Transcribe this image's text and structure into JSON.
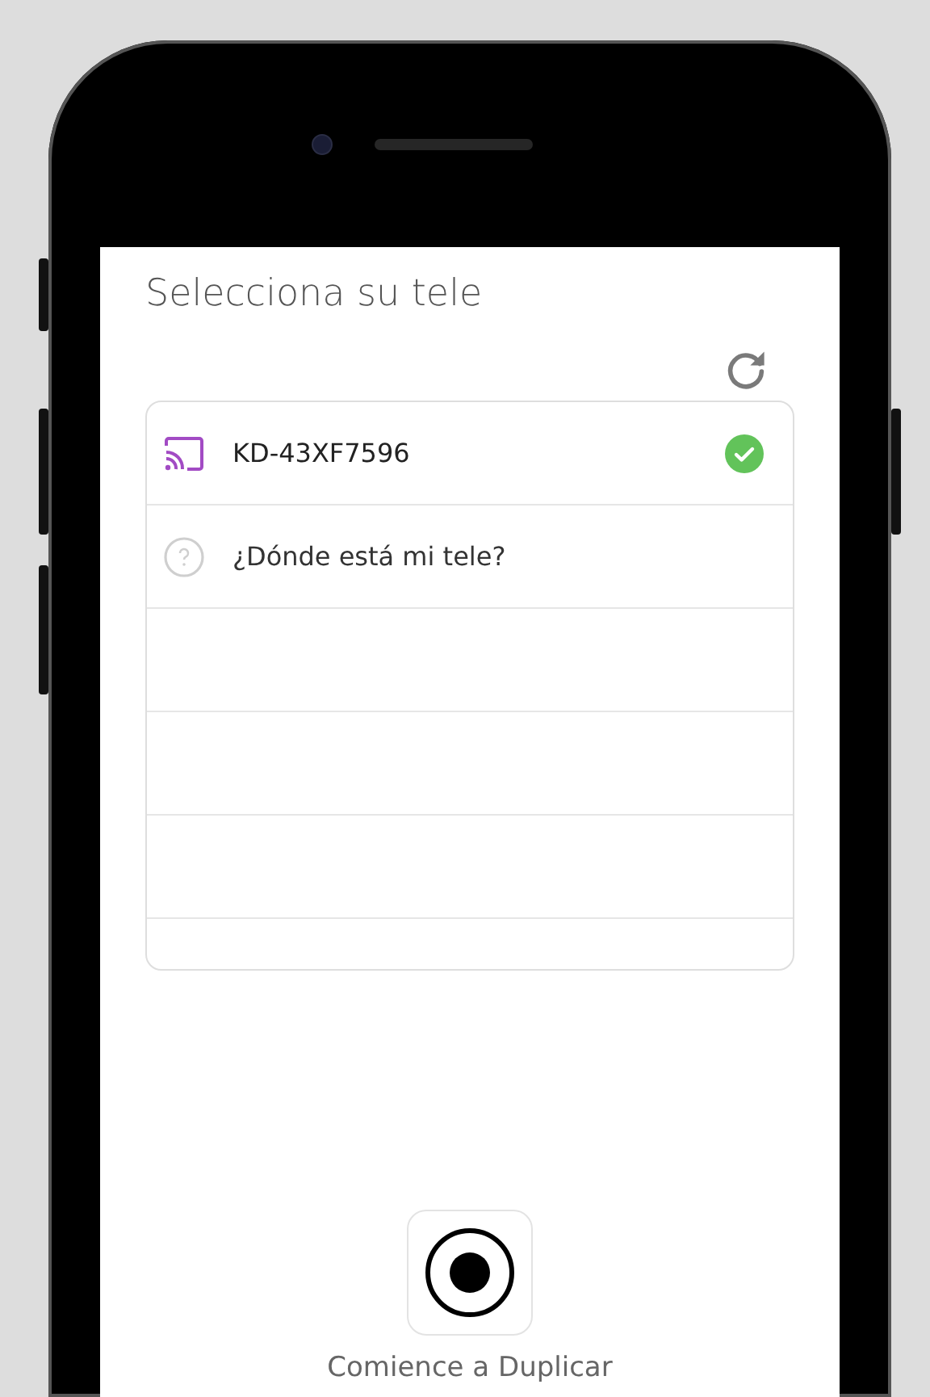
{
  "screen": {
    "title": "Selecciona su tele"
  },
  "devices": [
    {
      "kind": "tv",
      "label": "KD-43XF7596",
      "selected": true
    },
    {
      "kind": "help",
      "label": "¿Dónde está mi tele?",
      "selected": false
    }
  ],
  "record_button": {
    "label": "Comience a Duplicar"
  }
}
